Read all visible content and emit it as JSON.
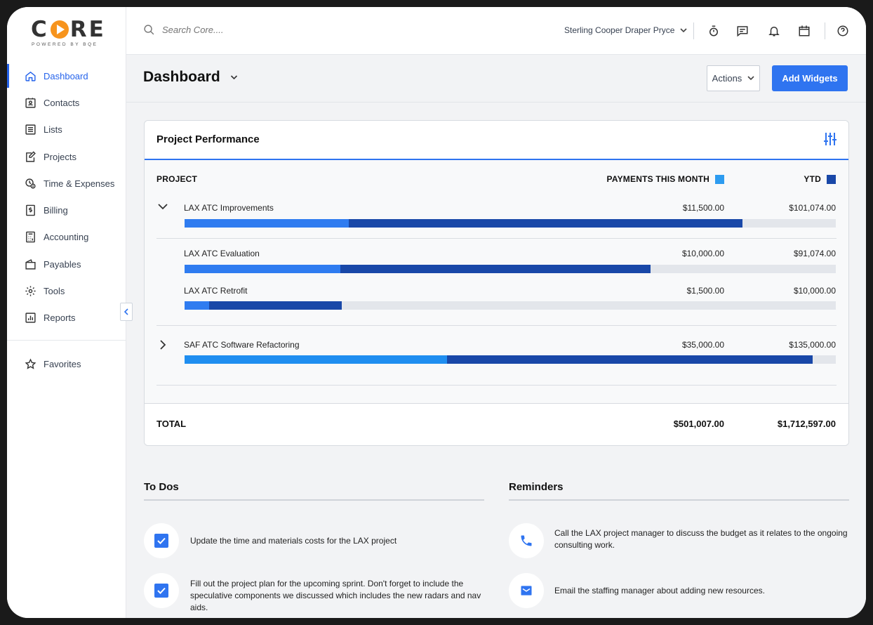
{
  "brand": {
    "name_left": "C",
    "name_right": "RE",
    "tagline": "POWERED BY BQE"
  },
  "sidebar": {
    "items": [
      {
        "label": "Dashboard",
        "icon": "home-icon",
        "active": true
      },
      {
        "label": "Contacts",
        "icon": "contact-card-icon"
      },
      {
        "label": "Lists",
        "icon": "list-icon"
      },
      {
        "label": "Projects",
        "icon": "edit-document-icon"
      },
      {
        "label": "Time & Expenses",
        "icon": "clock-dollar-icon"
      },
      {
        "label": "Billing",
        "icon": "billing-icon"
      },
      {
        "label": "Accounting",
        "icon": "calculator-icon"
      },
      {
        "label": "Payables",
        "icon": "payables-icon"
      },
      {
        "label": "Tools",
        "icon": "gear-icon"
      },
      {
        "label": "Reports",
        "icon": "bar-chart-icon"
      }
    ],
    "favorites": {
      "label": "Favorites",
      "icon": "star-icon"
    }
  },
  "topbar": {
    "search_placeholder": "Search Core....",
    "company": "Sterling Cooper Draper Pryce",
    "icons": [
      "stopwatch-icon",
      "message-icon",
      "bell-icon",
      "calendar-icon",
      "help-icon"
    ]
  },
  "page": {
    "title": "Dashboard",
    "actions_label": "Actions",
    "add_widgets_label": "Add Widgets"
  },
  "widget": {
    "title": "Project Performance",
    "col_project": "PROJECT",
    "col_payments": "PAYMENTS THIS MONTH",
    "col_ytd": "YTD",
    "colors": {
      "payments": "#2f7cf0",
      "ytd": "#1948a8",
      "track": "#e3e6eb",
      "payments_swatch": "#2d9cf0"
    },
    "rows": [
      {
        "label": "LAX ATC Improvements",
        "payments": "$11,500.00",
        "ytd": "$101,074.00",
        "pay_fraction": 0.252,
        "ytd_fraction": 0.857,
        "expanded": true
      },
      {
        "label": "LAX ATC Evaluation",
        "payments": "$10,000.00",
        "ytd": "$91,074.00",
        "pay_fraction": 0.239,
        "ytd_fraction": 0.716
      },
      {
        "label": "LAX ATC Retrofit",
        "payments": "$1,500.00",
        "ytd": "$10,000.00",
        "pay_fraction": 0.038,
        "ytd_fraction": 0.241
      },
      {
        "label": "SAF ATC Software Refactoring",
        "payments": "$35,000.00",
        "ytd": "$135,000.00",
        "pay_fraction": 0.403,
        "ytd_fraction": 0.964,
        "expanded": false
      }
    ],
    "total_label": "TOTAL",
    "total_payments": "$501,007.00",
    "total_ytd": "$1,712,597.00"
  },
  "todos": {
    "title": "To Dos",
    "items": [
      {
        "text": "Update the time and materials costs for the LAX project"
      },
      {
        "text": "Fill out the project plan for the upcoming sprint.  Don't forget to include the speculative components we discussed which includes the new radars and nav aids."
      }
    ]
  },
  "reminders": {
    "title": "Reminders",
    "items": [
      {
        "text": "Call the LAX project manager to discuss the budget as it relates to the ongoing consulting work.",
        "icon": "phone-icon"
      },
      {
        "text": "Email the staffing manager about adding new resources.",
        "icon": "mail-icon"
      }
    ]
  }
}
